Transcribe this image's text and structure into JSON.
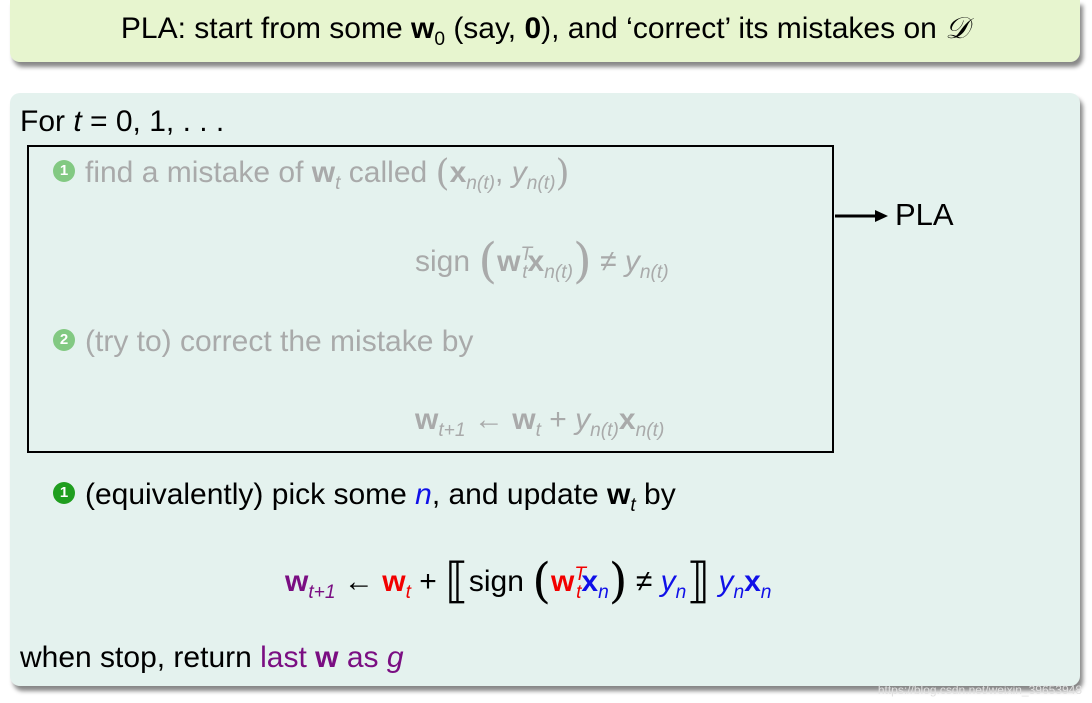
{
  "title": {
    "prefix": "PLA: start from some ",
    "w": "w",
    "w_sub": "0",
    "mid1": " (say, ",
    "zero": "0",
    "mid2": "), and ‘correct’ its mistakes on ",
    "D": "𝒟"
  },
  "main": {
    "for_prefix": "For ",
    "for_var": "t",
    "for_rest": " = 0, 1, . . .",
    "step1": {
      "num": "1",
      "text": "find a mistake of ",
      "w": "w",
      "sub": "t",
      "called": " called ",
      "x": "x",
      "x_sub": "n(t)",
      "comma": ", ",
      "y": "y",
      "y_sub": "n(t)"
    },
    "sign_eq": {
      "sign": "sign ",
      "w": "w",
      "w_sup": "T",
      "w_sub": "t",
      "x": "x",
      "x_sub": "n(t)",
      "neq": " ≠ ",
      "y": "y",
      "y_sub": "n(t)"
    },
    "step2": {
      "num": "2",
      "text": "(try to) correct the mistake by"
    },
    "update_eq": {
      "w": "w",
      "lhs_sub": "t+1",
      "arrow": " ← ",
      "w2": "w",
      "w2_sub": "t",
      "plus": " + ",
      "y": "y",
      "y_sub": "n(t)",
      "x": "x",
      "x_sub": "n(t)"
    },
    "pla_label": "PLA",
    "equiv": {
      "num": "1",
      "text1": "(equivalently) pick some ",
      "n": "n",
      "text2": ", and update ",
      "w": "w",
      "w_sub": "t",
      "text3": " by"
    },
    "final_eq": {
      "w": "w",
      "lhs_sub": "t+1",
      "arrow": " ← ",
      "w2": "w",
      "w2_sub": "t",
      "plus": " + ",
      "lbr": "⟦",
      "sign": "sign ",
      "w3": "w",
      "w3_sup": "T",
      "w3_sub": "t",
      "x": "x",
      "x_sub": "n",
      "neq": " ≠ ",
      "y": "y",
      "y_sub": "n",
      "rbr": "⟧",
      "y2": "y",
      "y2_sub": "n",
      "x2": "x",
      "x2_sub": "n"
    },
    "stop": {
      "text1": "when stop, return ",
      "last": "last ",
      "w": "w",
      "as": " as ",
      "g": "g"
    }
  },
  "watermark": "https://blog.csdn.net/weixin_39653948",
  "colors": {
    "title_bg": "#e7f5cf",
    "main_bg": "#e4f2ee",
    "purple": "#7a0e82",
    "red": "#f20000",
    "blue": "#1010e8",
    "gray": "#a9aaaa",
    "green_num": "#1f9e1f"
  }
}
